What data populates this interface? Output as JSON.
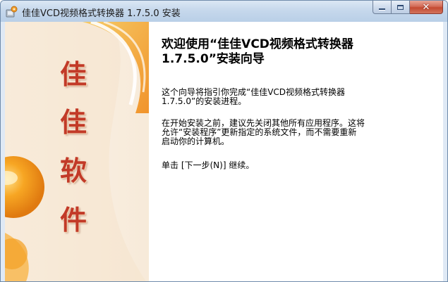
{
  "window": {
    "title": "佳佳VCD视频格式转换器 1.7.5.0 安装",
    "icon": "installer-app-icon"
  },
  "title_buttons": {
    "minimize": "minimize-icon",
    "maximize": "maximize-icon",
    "close_glyph": "✕"
  },
  "banner": {
    "brand_chars": [
      "佳",
      "佳",
      "软",
      "件"
    ]
  },
  "content": {
    "welcome_line1": "欢迎使用“佳佳VCD视频格式转换器",
    "welcome_line2": "1.7.5.0”安装向导",
    "para1_line1": "这个向导将指引你完成“佳佳VCD视频格式转换器",
    "para1_line2": "1.7.5.0”的安装进程。",
    "para2_line1": "在开始安装之前，建议先关闭其他所有应用程序。这将",
    "para2_line2": "允许“安装程序”更新指定的系统文件，而不需要重新",
    "para2_line3": "启动你的计算机。",
    "para3": "单击 [下一步(N)] 继续。"
  },
  "colors": {
    "brand_red": "#c23a28",
    "banner_orange": "#f29a1c",
    "close_red": "#c44a31"
  }
}
